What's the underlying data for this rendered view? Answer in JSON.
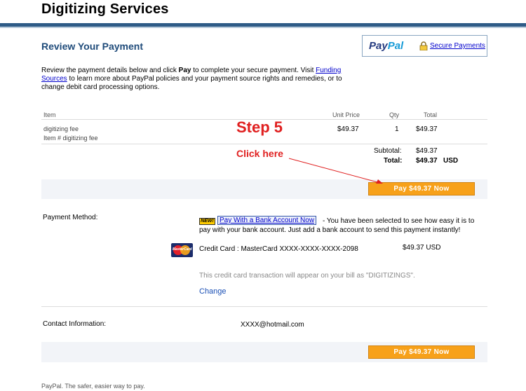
{
  "site": {
    "title": "Digitizing Services"
  },
  "page": {
    "heading": "Review Your Payment"
  },
  "paypal_box": {
    "logo_pay": "Pay",
    "logo_pal": "Pal",
    "secure_link": "Secure Payments"
  },
  "intro": {
    "part1": "Review the payment details below and click ",
    "pay_word": "Pay",
    "part2": " to complete your secure payment. Visit ",
    "link": "Funding Sources",
    "part3": " to learn more about PayPal policies and your payment source rights and remedies, or to change debit card processing options."
  },
  "table": {
    "headers": {
      "item": "Item",
      "unit_price": "Unit Price",
      "qty": "Qty",
      "total": "Total"
    },
    "row": {
      "name": "digitizing fee",
      "number": "Item # digitizing fee",
      "unit_price": "$49.37",
      "qty": "1",
      "total": "$49.37"
    },
    "subtotal_label": "Subtotal:",
    "subtotal_value": "$49.37",
    "total_label": "Total:",
    "total_value": "$49.37",
    "currency": "USD"
  },
  "annotations": {
    "step": "Step 5",
    "click_here": "Click here",
    "arrow_color": "#e02020"
  },
  "pay_button": {
    "label": "Pay $49.37 Now",
    "color": "#f7a11a"
  },
  "payment_method": {
    "label": "Payment Method:",
    "new_badge": "NEW!",
    "bank_link": "Pay With a Bank Account Now",
    "bank_text1": "- You have been selected to see how easy it is to",
    "bank_text2": "pay with your bank account. Just add a bank account to send this payment instantly!",
    "card_icon": "mastercard-icon",
    "card_logo_text": "MasterCard",
    "card_text": "Credit Card : MasterCard XXXX-XXXX-XXXX-2098",
    "card_amount": "$49.37 USD",
    "card_note": "This credit card transaction will appear on your bill as \"DIGITIZINGS\".",
    "change_link": "Change"
  },
  "contact": {
    "label": "Contact Information:",
    "value": "XXXX@hotmail.com"
  },
  "footer": {
    "text": "PayPal. The safer, easier way to pay."
  }
}
